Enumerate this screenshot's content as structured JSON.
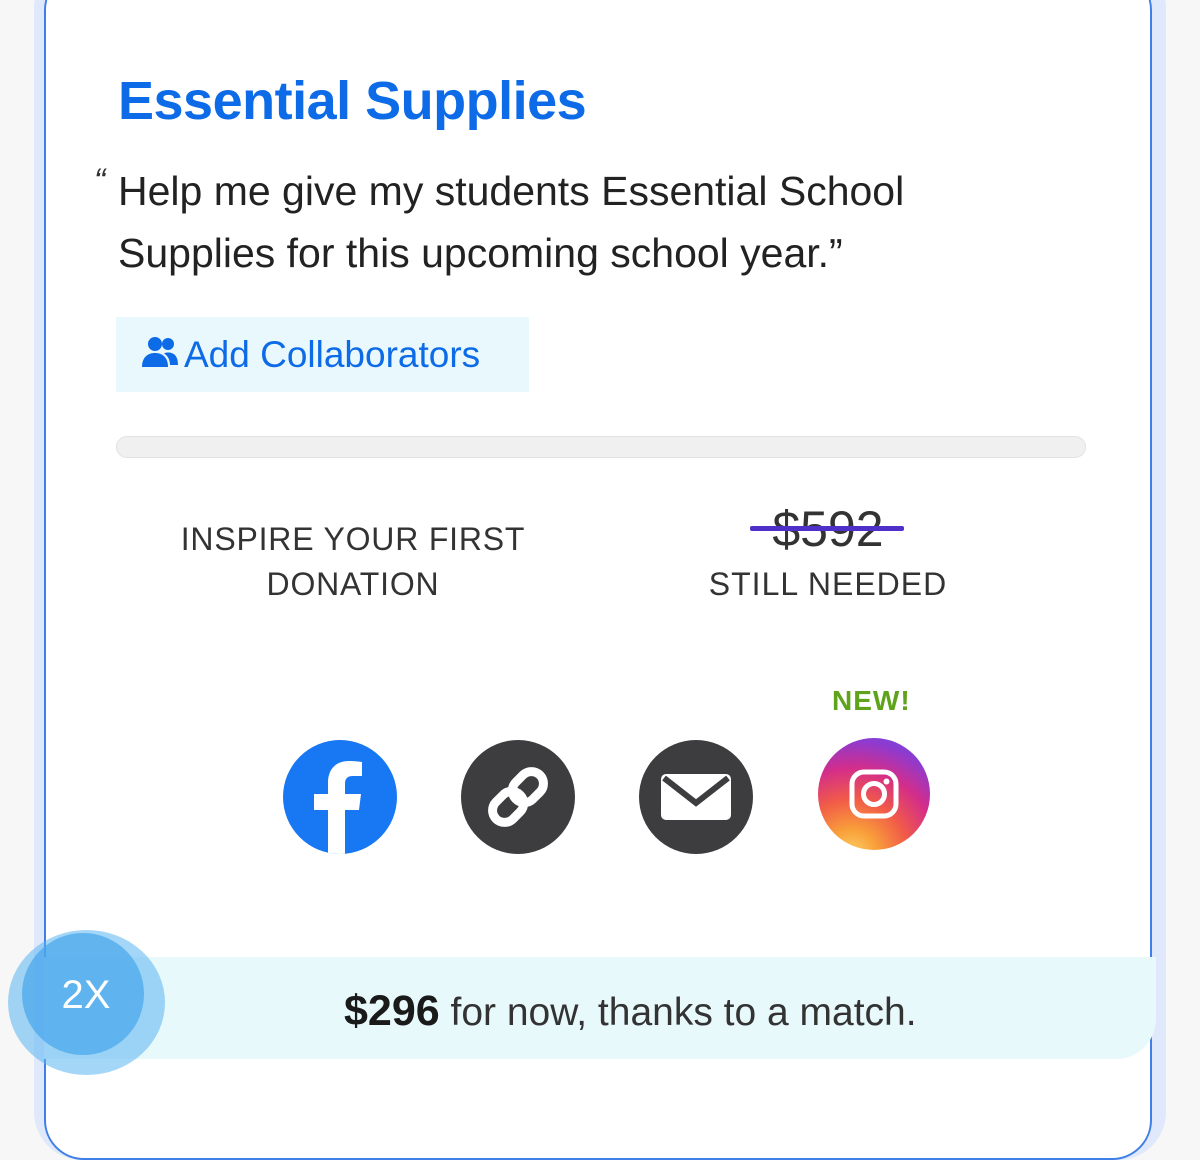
{
  "project": {
    "title": "Essential Supplies",
    "quote_open": "“",
    "quote": "Help me give my students Essential School Supplies for this upcoming school year.”"
  },
  "collaborators": {
    "button_label": "Add Collaborators",
    "icon": "users-icon"
  },
  "progress": {
    "fraction_funded": 0.0
  },
  "stats": {
    "left_label": "INSPIRE YOUR FIRST DONATION",
    "original_amount": "$592",
    "right_label": "STILL NEEDED"
  },
  "share": {
    "new_badge": "NEW!",
    "icons": [
      "facebook-icon",
      "link-icon",
      "email-icon",
      "instagram-icon"
    ]
  },
  "match": {
    "badge": "2X",
    "amount": "$296",
    "text": " for now, thanks to a match."
  },
  "colors": {
    "brand_blue": "#0d6be8",
    "strike_purple": "#4e2fc9",
    "new_green": "#5fa31a",
    "facebook_blue": "#1877f2",
    "dark_icon": "#3d3d3f"
  }
}
